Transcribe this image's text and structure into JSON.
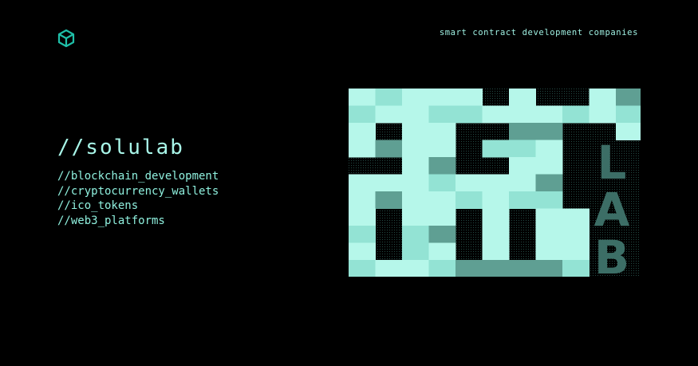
{
  "header": {
    "tagline": "smart contract development companies",
    "logo_icon": "cube-icon"
  },
  "brand": {
    "title": "//solulab"
  },
  "services": [
    "//blockchain_development",
    "//cryptocurrency_wallets",
    "//ico_tokens",
    "//web3_platforms"
  ],
  "artwork": {
    "letters": [
      "L",
      "A",
      "B"
    ]
  },
  "colors": {
    "background": "#000000",
    "accent": "#1fbfa8",
    "text": "#a8f5e8",
    "tile_light": "#b6f7ea",
    "tile_mid": "#93e3d4",
    "tile_dark": "#5f9f93",
    "lab_letters": "#3c6e66"
  }
}
